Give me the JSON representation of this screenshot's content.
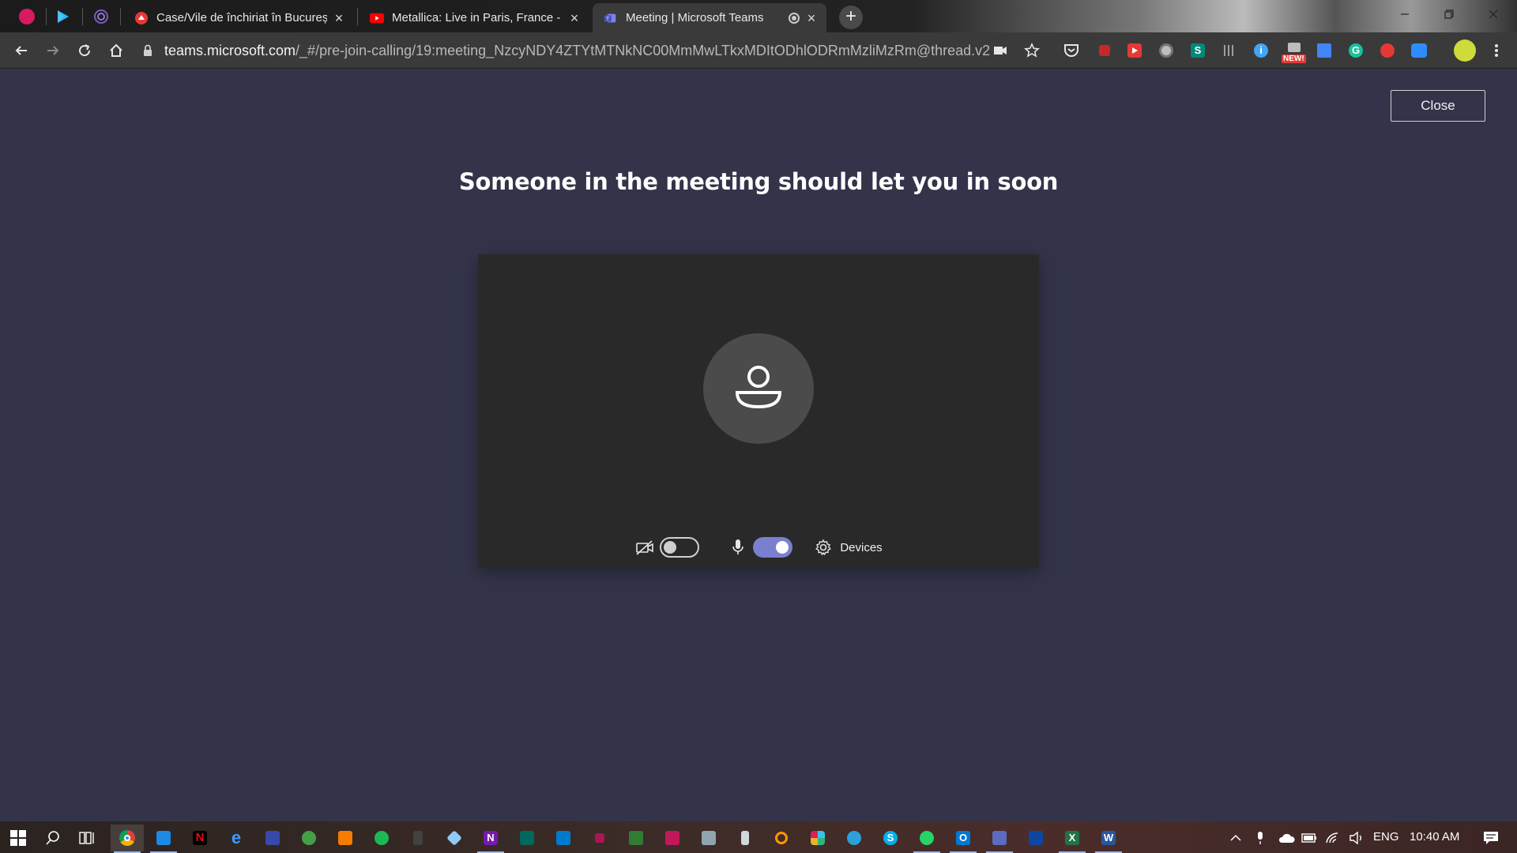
{
  "browser": {
    "tabs": [
      {
        "title": "Case/Vile de închiriat în București",
        "color": "#e53935",
        "active": false
      },
      {
        "title": "Metallica: Live in Paris, France - S",
        "color": "#ff0000",
        "active": false
      },
      {
        "title": "Meeting | Microsoft Teams",
        "color": "#6264a7",
        "active": true
      }
    ],
    "new_tab_label": "+",
    "url_host": "teams.microsoft.com",
    "url_path": "/_#/pre-join-calling/19:meeting_NzcyNDY4ZTYtMTNkNC00MmMwLTkxMDItODhlODRmMzliMzRm@thread.v2",
    "ext_badge_new": "NEW!"
  },
  "page": {
    "close_label": "Close",
    "title": "Someone in the meeting should let you in soon",
    "controls": {
      "camera_on": false,
      "mic_on": true,
      "devices_label": "Devices"
    }
  },
  "taskbar": {
    "language": "ENG",
    "time": "10:40 AM"
  },
  "colors": {
    "page_bg": "#33344a",
    "card_bg": "#292929",
    "accent": "#7b7fcf"
  }
}
